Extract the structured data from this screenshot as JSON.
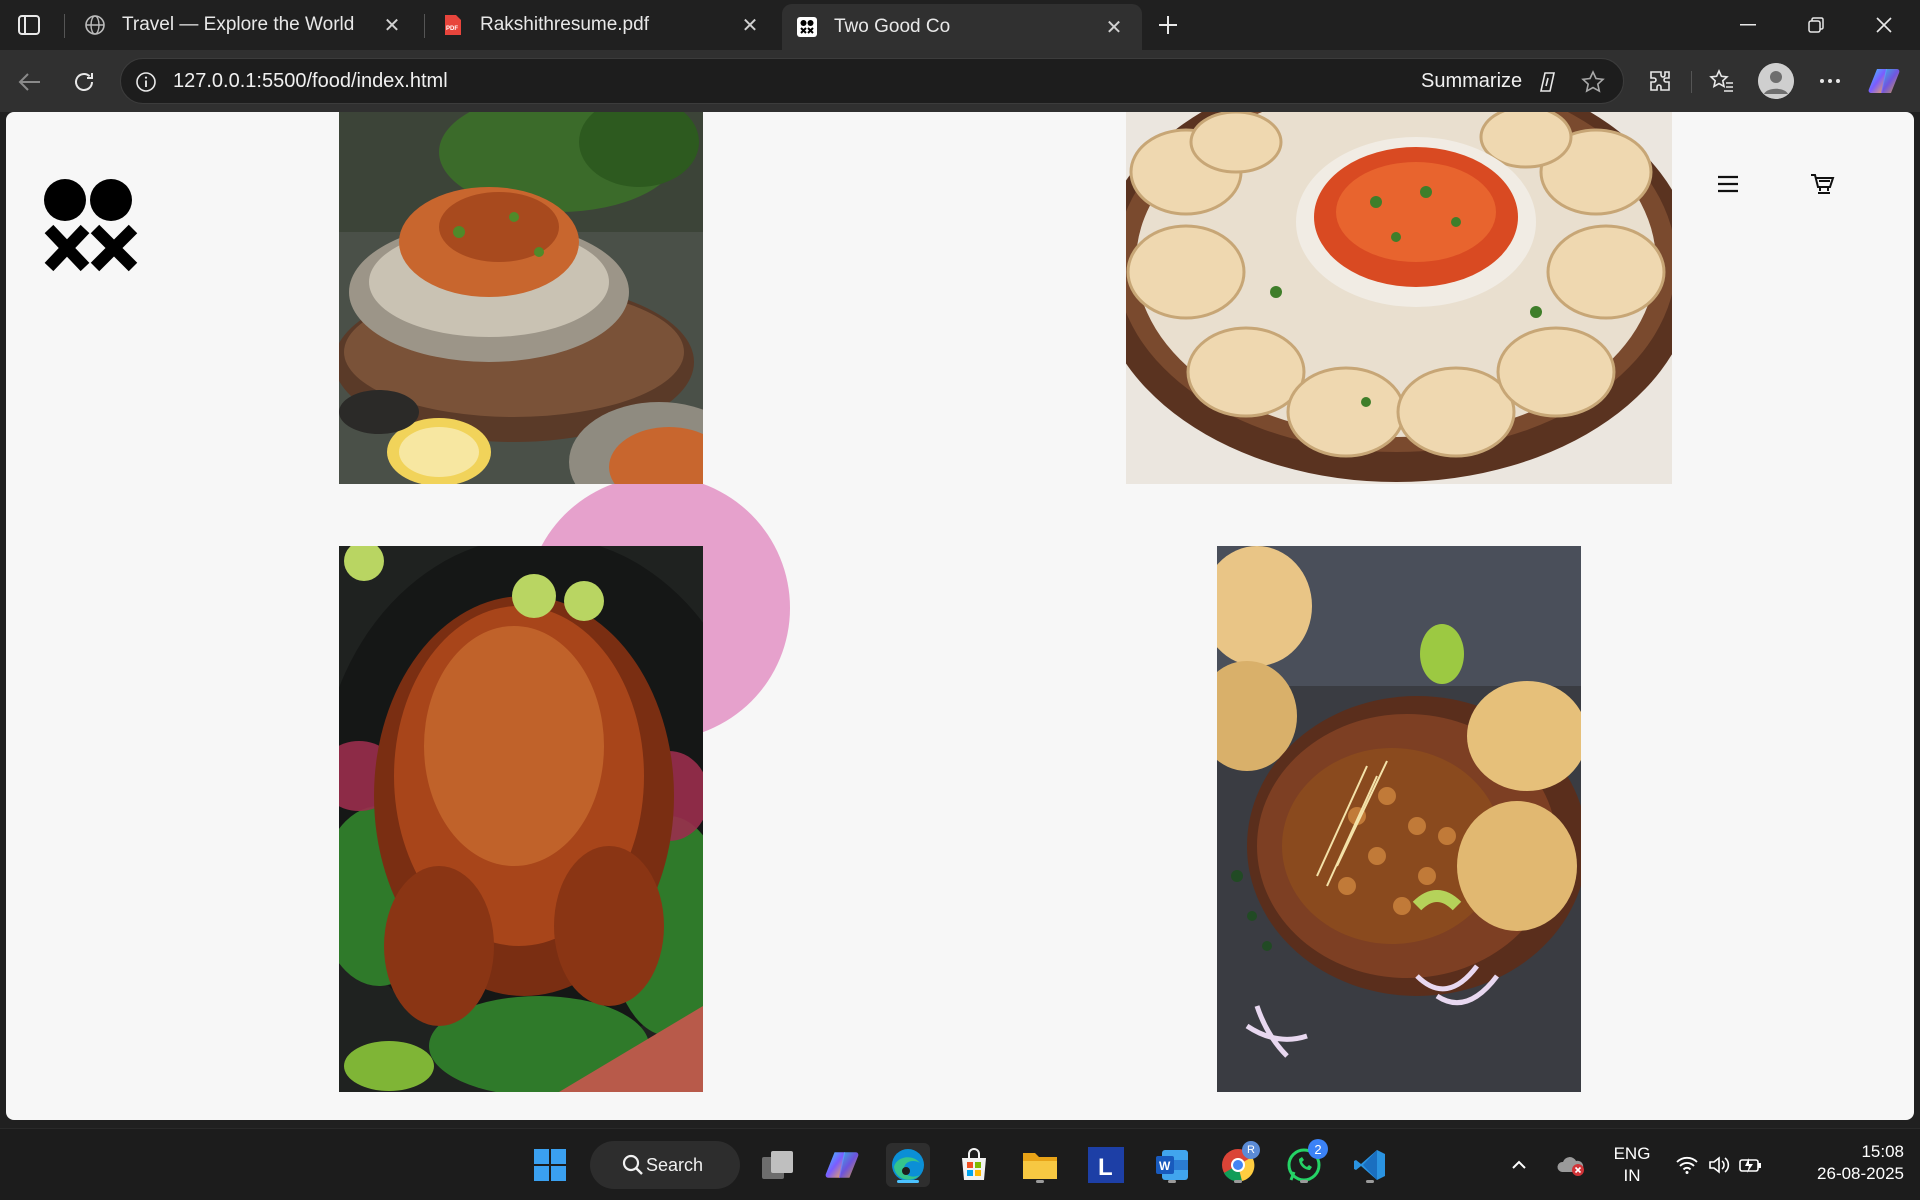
{
  "browser": {
    "tabs": [
      {
        "label": "Travel — Explore the World",
        "icon": "globe-icon"
      },
      {
        "label": "Rakshithresume.pdf",
        "icon": "pdf-icon"
      },
      {
        "label": "Two Good Co",
        "icon": "twogood-favicon",
        "active": true
      }
    ],
    "address": "127.0.0.1:5500/food/index.html",
    "summarize_label": "Summarize"
  },
  "page": {
    "accent_color": "#e6a1cc",
    "header": {
      "logo": "two-good-co-logo",
      "menu_icon": "hamburger-icon",
      "cart_icon": "cart-icon"
    },
    "images": [
      {
        "name": "pasta-image",
        "alt": "spaghetti bowl"
      },
      {
        "name": "momos-image",
        "alt": "dumplings with chutney"
      },
      {
        "name": "roast-chicken-image",
        "alt": "roasted chicken"
      },
      {
        "name": "chole-bhature-image",
        "alt": "chickpea curry with puris"
      }
    ]
  },
  "taskbar": {
    "search_label": "Search",
    "language": {
      "line1": "ENG",
      "line2": "IN"
    },
    "clock": {
      "time": "15:08",
      "date": "26-08-2025"
    },
    "whatsapp_badge": "2",
    "chrome_badge": "R"
  }
}
